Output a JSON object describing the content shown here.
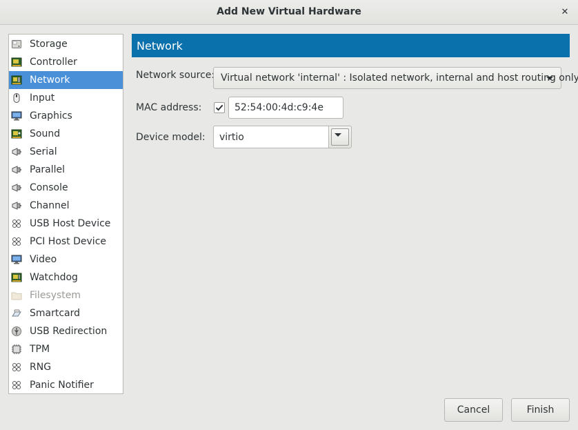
{
  "window": {
    "title": "Add New Virtual Hardware"
  },
  "sidebar": {
    "items": [
      {
        "label": "Storage",
        "icon": "disk-icon",
        "state": "normal"
      },
      {
        "label": "Controller",
        "icon": "controller-icon",
        "state": "normal"
      },
      {
        "label": "Network",
        "icon": "network-icon",
        "state": "selected"
      },
      {
        "label": "Input",
        "icon": "mouse-icon",
        "state": "normal"
      },
      {
        "label": "Graphics",
        "icon": "monitor-icon",
        "state": "normal"
      },
      {
        "label": "Sound",
        "icon": "sound-card-icon",
        "state": "normal"
      },
      {
        "label": "Serial",
        "icon": "serial-port-icon",
        "state": "normal"
      },
      {
        "label": "Parallel",
        "icon": "parallel-port-icon",
        "state": "normal"
      },
      {
        "label": "Console",
        "icon": "console-port-icon",
        "state": "normal"
      },
      {
        "label": "Channel",
        "icon": "channel-port-icon",
        "state": "normal"
      },
      {
        "label": "USB Host Device",
        "icon": "usb-host-icon",
        "state": "normal"
      },
      {
        "label": "PCI Host Device",
        "icon": "pci-host-icon",
        "state": "normal"
      },
      {
        "label": "Video",
        "icon": "video-monitor-icon",
        "state": "normal"
      },
      {
        "label": "Watchdog",
        "icon": "watchdog-icon",
        "state": "normal"
      },
      {
        "label": "Filesystem",
        "icon": "folder-icon",
        "state": "disabled"
      },
      {
        "label": "Smartcard",
        "icon": "smartcard-icon",
        "state": "normal"
      },
      {
        "label": "USB Redirection",
        "icon": "usb-redirect-icon",
        "state": "normal"
      },
      {
        "label": "TPM",
        "icon": "tpm-chip-icon",
        "state": "normal"
      },
      {
        "label": "RNG",
        "icon": "rng-icon",
        "state": "normal"
      },
      {
        "label": "Panic Notifier",
        "icon": "panic-notifier-icon",
        "state": "normal"
      }
    ]
  },
  "page": {
    "header": "Network",
    "network_source": {
      "label": "Network source:",
      "value": "Virtual network 'internal' : Isolated network, internal and host routing only"
    },
    "mac": {
      "label": "MAC address:",
      "checked": true,
      "value": "52:54:00:4d:c9:4e"
    },
    "device_model": {
      "label": "Device model:",
      "value": "virtio"
    }
  },
  "buttons": {
    "cancel": "Cancel",
    "finish": "Finish"
  },
  "colors": {
    "header_bg": "#0a71ac",
    "selection_bg": "#4a90d9"
  }
}
